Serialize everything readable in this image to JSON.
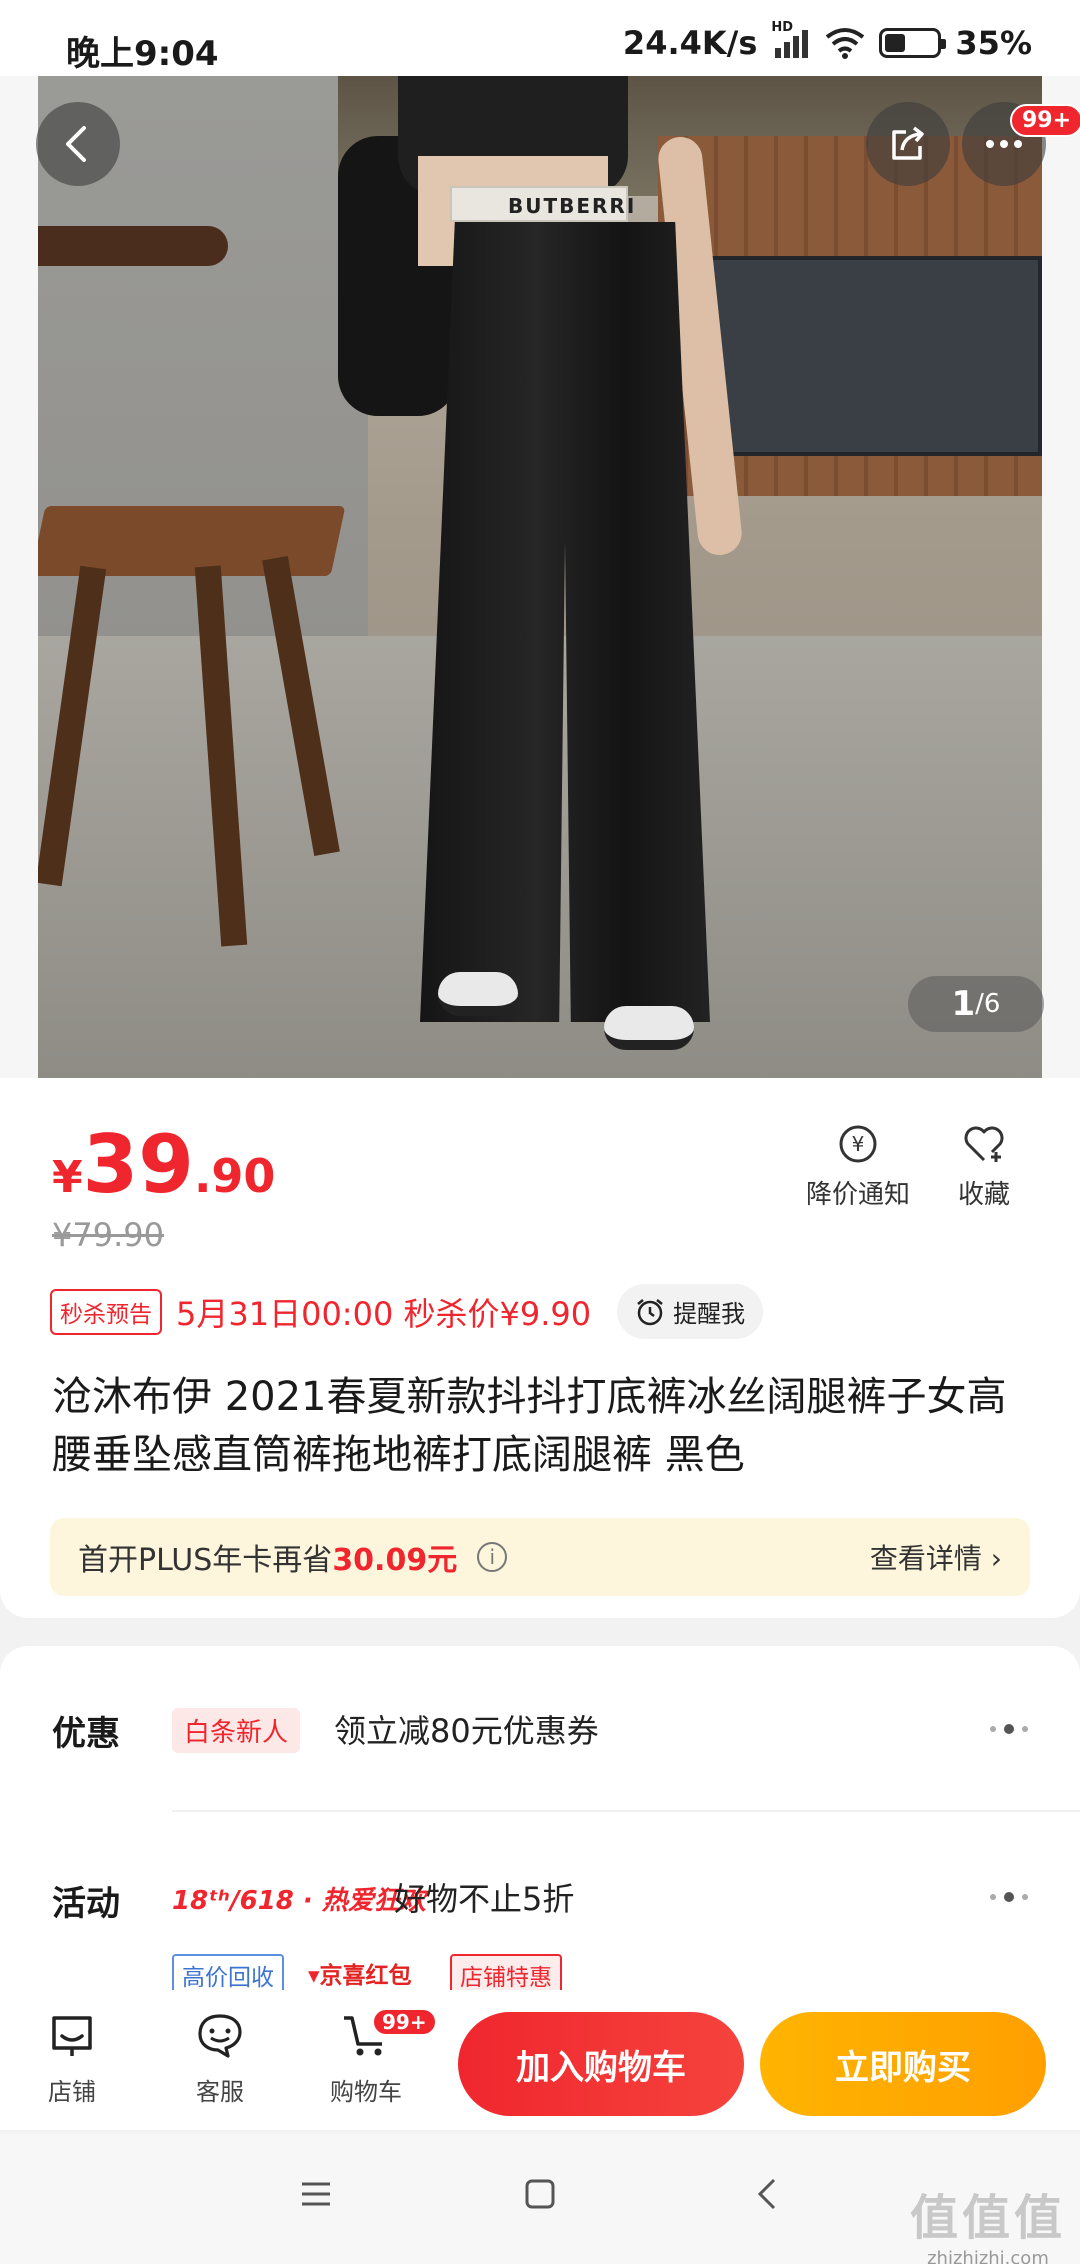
{
  "status_bar": {
    "time": "晚上9:04",
    "net_speed": "24.4K/s",
    "hd_label": "HD",
    "battery_pct": "35%",
    "battery_level": 0.35
  },
  "gallery": {
    "waistband_text": "BUTBERRI",
    "pager_current": "1",
    "pager_total": "/6",
    "more_badge": "99+"
  },
  "product": {
    "price_currency": "¥",
    "price_int": "39",
    "price_dec": ".90",
    "original_price": "¥79.90",
    "actions": [
      {
        "label": "降价通知",
        "icon": "price-drop-bell-icon"
      },
      {
        "label": "收藏",
        "icon": "heart-plus-icon"
      }
    ],
    "flash_tag": "秒杀预告",
    "flash_text": "5月31日00:00 秒杀价¥9.90",
    "remind_label": "提醒我",
    "title": "沧沐布伊 2021春夏新款抖抖打底裤冰丝阔腿裤子女高腰垂坠感直筒裤拖地裤打底阔腿裤 黑色"
  },
  "plus_banner": {
    "text_prefix": "首开PLUS年卡再省",
    "amount": "30.09元",
    "info_glyph": "i",
    "detail": "查看详情 ›"
  },
  "promo": {
    "discount_label": "优惠",
    "discount_chip": "白条新人",
    "discount_text": "领立减80元优惠券",
    "activity_label": "活动",
    "activity_brand": "18ᵗʰ/618 · 热爱狂欢",
    "activity_text": "好物不止5折",
    "tags": [
      "高价回收",
      "京喜红包",
      "店铺特惠"
    ]
  },
  "bottom_bar": {
    "store": "店铺",
    "service": "客服",
    "cart": "购物车",
    "cart_badge": "99+",
    "add_to_cart": "加入购物车",
    "buy_now": "立即购买"
  },
  "watermark": {
    "big": "值值值",
    "small": "zhizhizhi.com"
  },
  "colors": {
    "accent_red": "#f0262e",
    "buy_orange": "#ffb400",
    "plus_bg": "#fdf6dd"
  }
}
